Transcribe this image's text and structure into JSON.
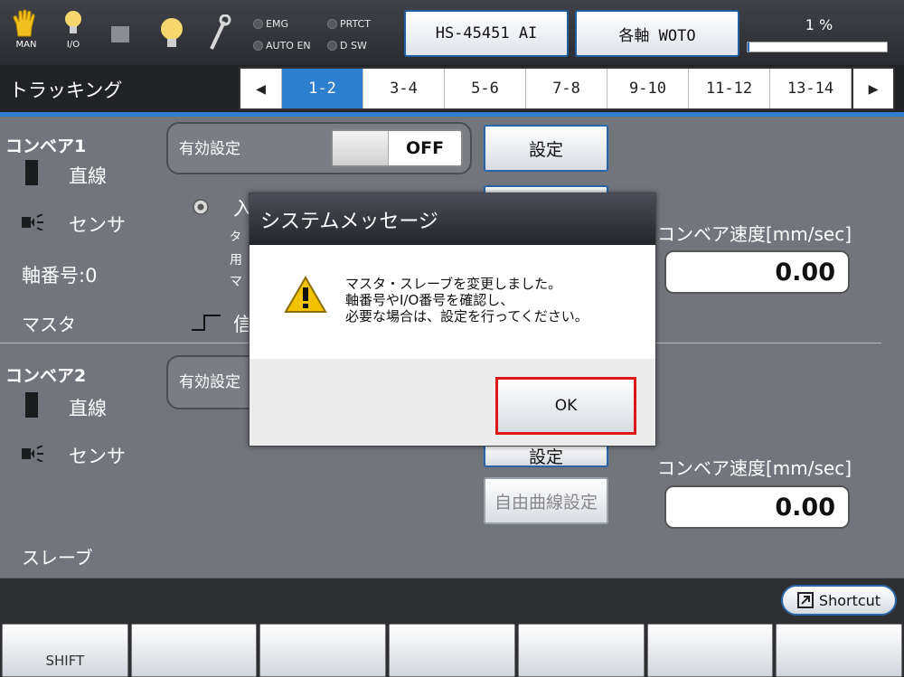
{
  "status_bar": {
    "man_label": "MAN",
    "io_label": "I/O",
    "leds": {
      "emg": "EMG",
      "prtct": "PRTCT",
      "auto_en": "AUTO EN",
      "d_sw": "D SW"
    },
    "program_button": "HS-45451 AI",
    "axis_button": "各軸 WOTO",
    "percent_label": "1 %",
    "percent_value": 0.01
  },
  "title_bar": {
    "title": "トラッキング",
    "tabs": [
      "1-2",
      "3-4",
      "5-6",
      "7-8",
      "9-10",
      "11-12",
      "13-14"
    ],
    "active_tab": "1-2",
    "prev_icon": "◀",
    "next_icon": "▶"
  },
  "conveyor1": {
    "header": "コンベア1",
    "type_label": "直線",
    "sensor_label": "センサ",
    "axis_label": "軸番号:0",
    "role_label": "マスタ",
    "enable_label": "有効設定",
    "enable_state": "OFF",
    "setting_button": "設定",
    "partial_texts": [
      "入",
      "タ",
      "用",
      "マ",
      "信"
    ],
    "speed_label": "コンベア速度[mm/sec]",
    "speed_value": "0.00"
  },
  "conveyor2": {
    "header": "コンベア2",
    "type_label": "直線",
    "sensor_label": "センサ",
    "role_label": "スレーブ",
    "enable_label": "有効設定",
    "setting_button": "設定",
    "curve_button": "自由曲線設定",
    "speed_label": "コンベア速度[mm/sec]",
    "speed_value": "0.00"
  },
  "dialog": {
    "title": "システムメッセージ",
    "message_lines": [
      "マスタ・スレーブを変更しました。",
      "軸番号やI/O番号を確認し、",
      "必要な場合は、設定を行ってください。"
    ],
    "ok_label": "OK"
  },
  "bottom": {
    "shortcut_label": "Shortcut",
    "function_keys": [
      "SHIFT",
      "",
      "",
      "",
      "",
      "",
      ""
    ]
  },
  "colors": {
    "accent": "#2e7fd0",
    "highlight_border": "#e01515",
    "warning": "#f2c200"
  }
}
